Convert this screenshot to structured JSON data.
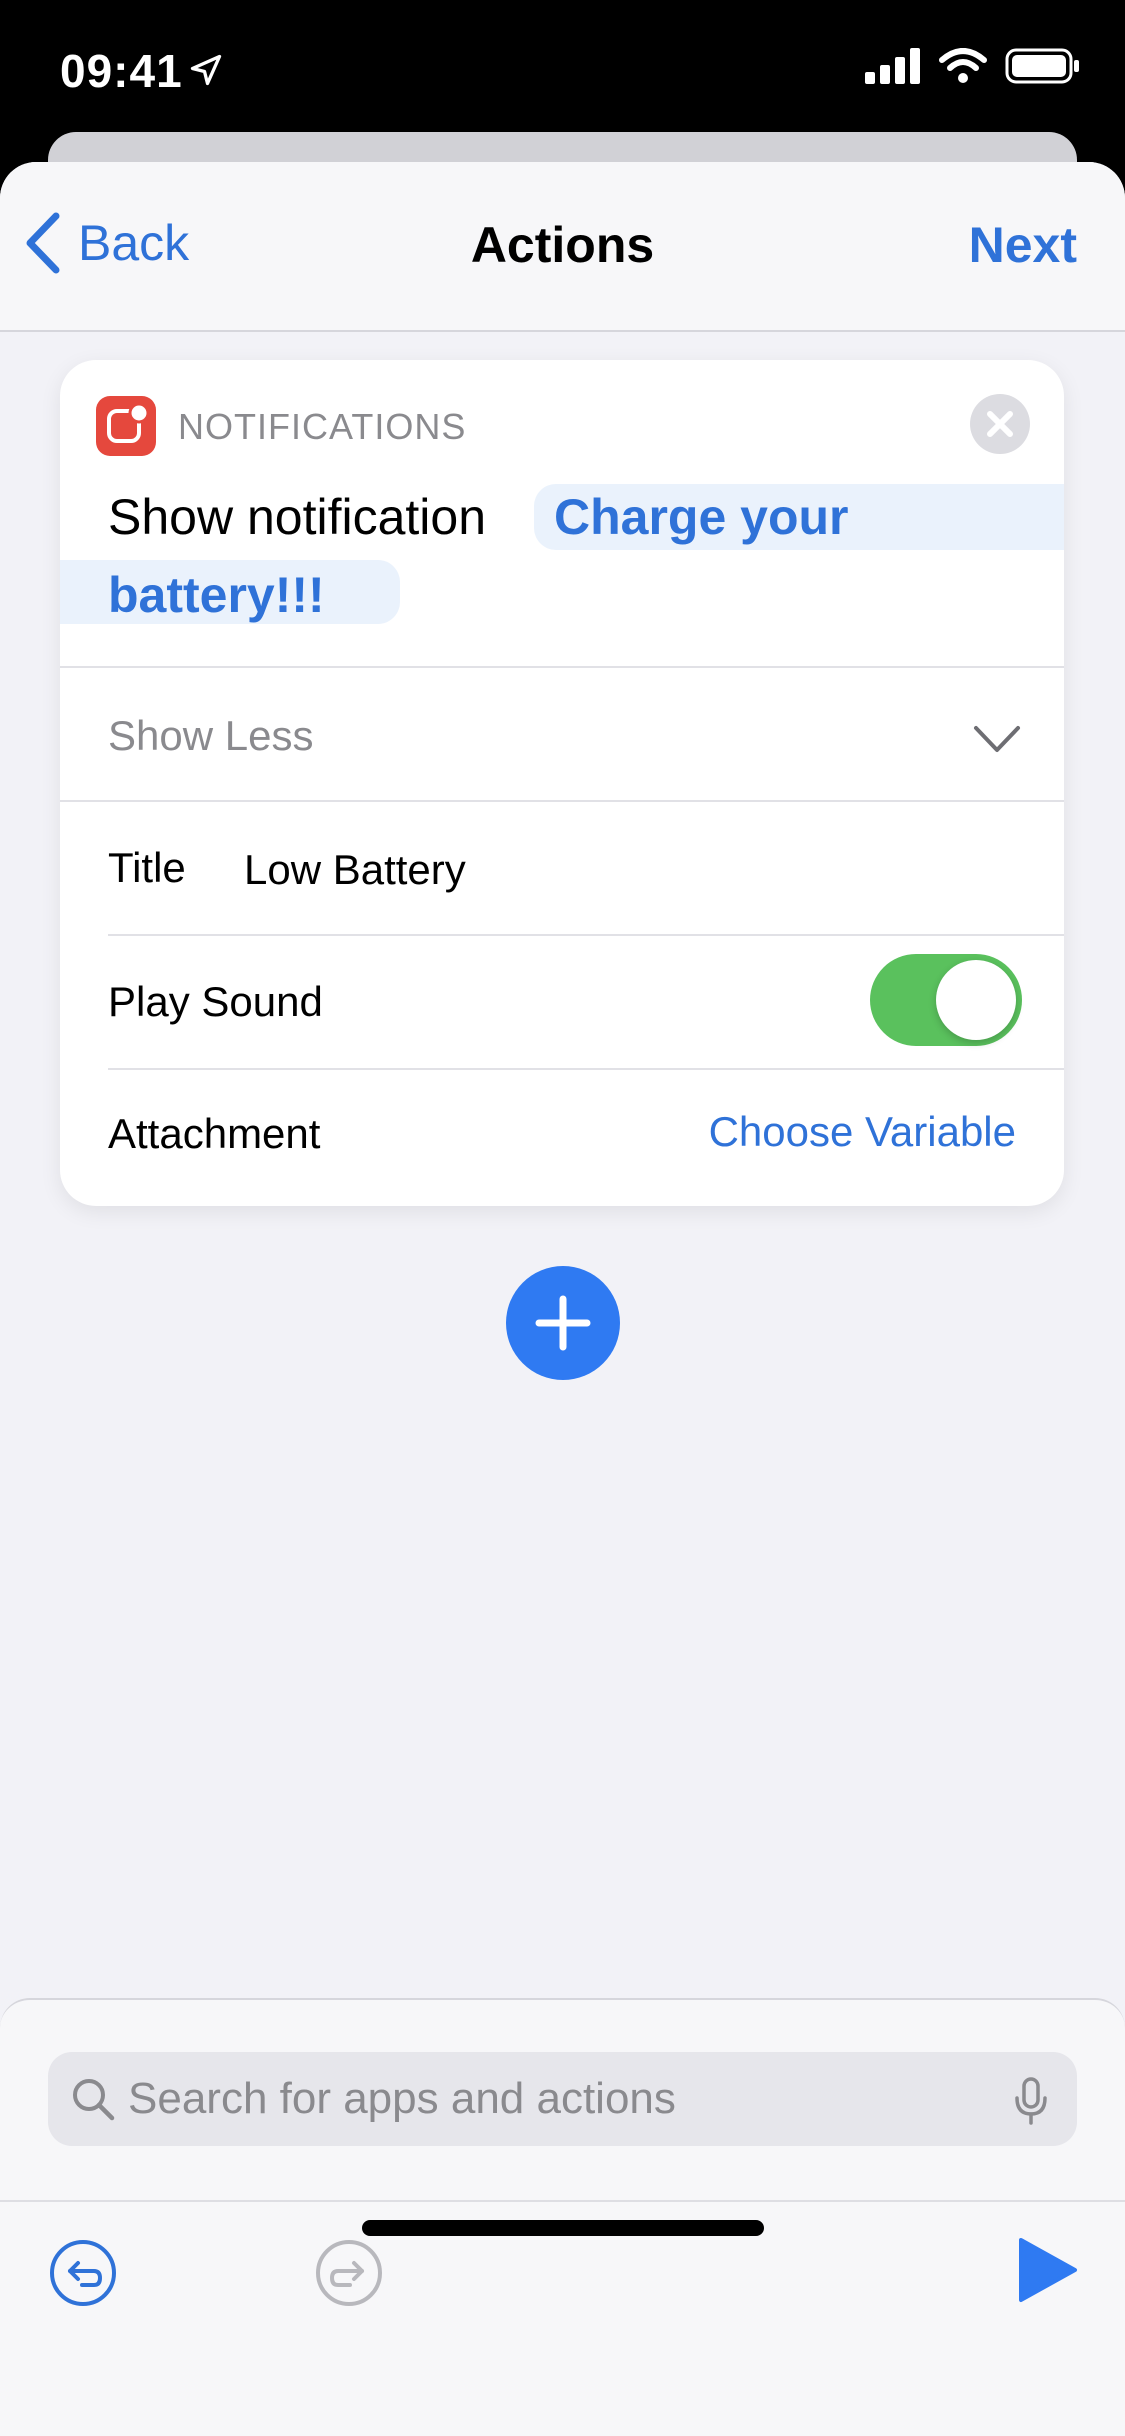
{
  "status_bar": {
    "time": "09:41",
    "location_icon": "location-arrow-icon",
    "signal_icon": "cellular-signal-icon",
    "wifi_icon": "wifi-icon",
    "battery_icon": "battery-icon"
  },
  "nav": {
    "back_label": "Back",
    "title": "Actions",
    "next_label": "Next"
  },
  "action_card": {
    "category": "NOTIFICATIONS",
    "action_label": "Show notification",
    "message_line1": "Charge your",
    "message_line2": "battery!!!",
    "show_less_label": "Show Less",
    "title_label": "Title",
    "title_value": "Low Battery",
    "play_sound_label": "Play Sound",
    "play_sound_on": true,
    "attachment_label": "Attachment",
    "attachment_value": "Choose Variable"
  },
  "search": {
    "placeholder": "Search for apps and actions"
  },
  "colors": {
    "accent": "#2f72d8",
    "toggle_on": "#5ac15d",
    "notification_app": "#e5483d",
    "add_button": "#2f7af2"
  }
}
